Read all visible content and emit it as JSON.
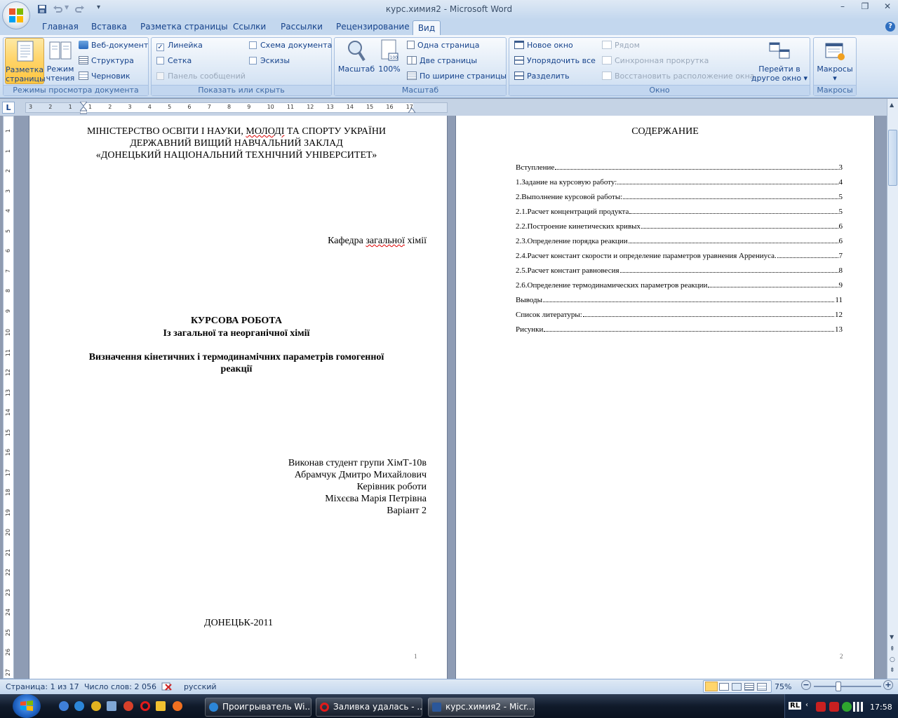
{
  "window": {
    "title": "курс.химия2 - Microsoft Word"
  },
  "tabs": [
    "Главная",
    "Вставка",
    "Разметка страницы",
    "Ссылки",
    "Рассылки",
    "Рецензирование",
    "Вид"
  ],
  "ribbon": {
    "modes": {
      "group_label": "Режимы просмотра документа",
      "page_layout": "Разметка страницы",
      "page_layout_l1": "Разметка",
      "page_layout_l2": "страницы",
      "reading_l1": "Режим",
      "reading_l2": "чтения",
      "web": "Веб-документ",
      "outline": "Структура",
      "draft": "Черновик"
    },
    "show": {
      "group_label": "Показать или скрыть",
      "ruler": "Линейка",
      "ruler_checked": true,
      "gridlines": "Сетка",
      "message_bar": "Панель сообщений",
      "doc_map": "Схема документа",
      "thumbnails": "Эскизы"
    },
    "zoom": {
      "group_label": "Масштаб",
      "zoom": "Масштаб",
      "percent100": "100%",
      "one_page": "Одна страница",
      "two_pages": "Две страницы",
      "page_width": "По ширине страницы"
    },
    "window": {
      "group_label": "Окно",
      "new_window": "Новое окно",
      "arrange_all": "Упорядочить все",
      "split": "Разделить",
      "side_by_side": "Рядом",
      "sync_scroll": "Синхронная прокрутка",
      "reset_pos": "Восстановить расположение окна",
      "switch_l1": "Перейти в",
      "switch_l2": "другое окно"
    },
    "macros": {
      "group_label": "Макросы",
      "macros": "Макросы"
    }
  },
  "ruler": {
    "ticks": [
      "3",
      "2",
      "1",
      "1",
      "2",
      "3",
      "4",
      "5",
      "6",
      "7",
      "8",
      "9",
      "10",
      "11",
      "12",
      "13",
      "14",
      "15",
      "16",
      "17"
    ],
    "vticks": [
      "1",
      "1",
      "2",
      "3",
      "4",
      "5",
      "6",
      "7",
      "8",
      "9",
      "10",
      "11",
      "12",
      "13",
      "14",
      "15",
      "16",
      "17",
      "18",
      "19",
      "20",
      "21",
      "22",
      "23",
      "24",
      "25",
      "26",
      "27"
    ]
  },
  "page1": {
    "header1": "МІНІСТЕРСТВО ОСВІТИ І НАУКИ, МОЛОДІ ТА СПОРТУ УКРАЇНИ",
    "header2": "ДЕРЖАВНИЙ ВИЩИЙ НАВЧАЛЬНИЙ ЗАКЛАД",
    "header3": "«ДОНЕЦЬКИЙ НАЦІОНАЛЬНИЙ ТЕХНІЧНИЙ УНІВЕРСИТЕТ»",
    "dept": "Кафедра загальної хімії",
    "title": "КУРСОВА РОБОТА",
    "subject": "Із загальної та неорганічної хімії",
    "topic1": "Визначення кінетичних і термодинамічних параметрів гомогенної",
    "topic2": "реакції",
    "author1": "Виконав студент групи ХімТ-10в",
    "author2": "Абрамчук Дмитро Михайлович",
    "author3": "Керівник роботи",
    "author4": "Міхєєва Марія Петрівна",
    "author5": "Варіант 2",
    "city": "ДОНЕЦЬК-2011",
    "page_no": "1"
  },
  "page2": {
    "heading": "СОДЕРЖАНИЕ",
    "toc": [
      {
        "t": "Вступление",
        "p": "3"
      },
      {
        "t": "1.Задание на курсовую работу:",
        "p": "4"
      },
      {
        "t": "2.Выполнение курсовой работы:",
        "p": "5"
      },
      {
        "t": "2.1.Расчет концентраций продукта",
        "p": "5"
      },
      {
        "t": "2.2.Построение кинетических кривых",
        "p": "6"
      },
      {
        "t": "2.3.Определение порядка реакции",
        "p": "6"
      },
      {
        "t": "2.4.Расчет констант скорости и определение параметров уравнения Аррениуса.",
        "p": "7"
      },
      {
        "t": "2.5.Расчет констант равновесия",
        "p": "8"
      },
      {
        "t": "2.6.Определение термодинамических параметров реакции",
        "p": "9"
      },
      {
        "t": "Выводы",
        "p": "11"
      },
      {
        "t": "Список литературы:",
        "p": "12"
      },
      {
        "t": "Рисунки",
        "p": "13"
      }
    ],
    "page_no": "2"
  },
  "status": {
    "page": "Страница: 1 из 17",
    "words": "Число слов: 2 056",
    "lang": "русский",
    "zoom": "75%",
    "zoom_level": 0.75
  },
  "taskbar": {
    "items": [
      "Проигрыватель Wi...",
      "Заливка удалась - ...",
      "курс.химия2 - Micr..."
    ],
    "lang": "RL",
    "clock": "17:58"
  },
  "colors": {
    "ribbon_text": "#15428b",
    "accent": "#8ba9cf",
    "active_view": "#ffd56b"
  }
}
